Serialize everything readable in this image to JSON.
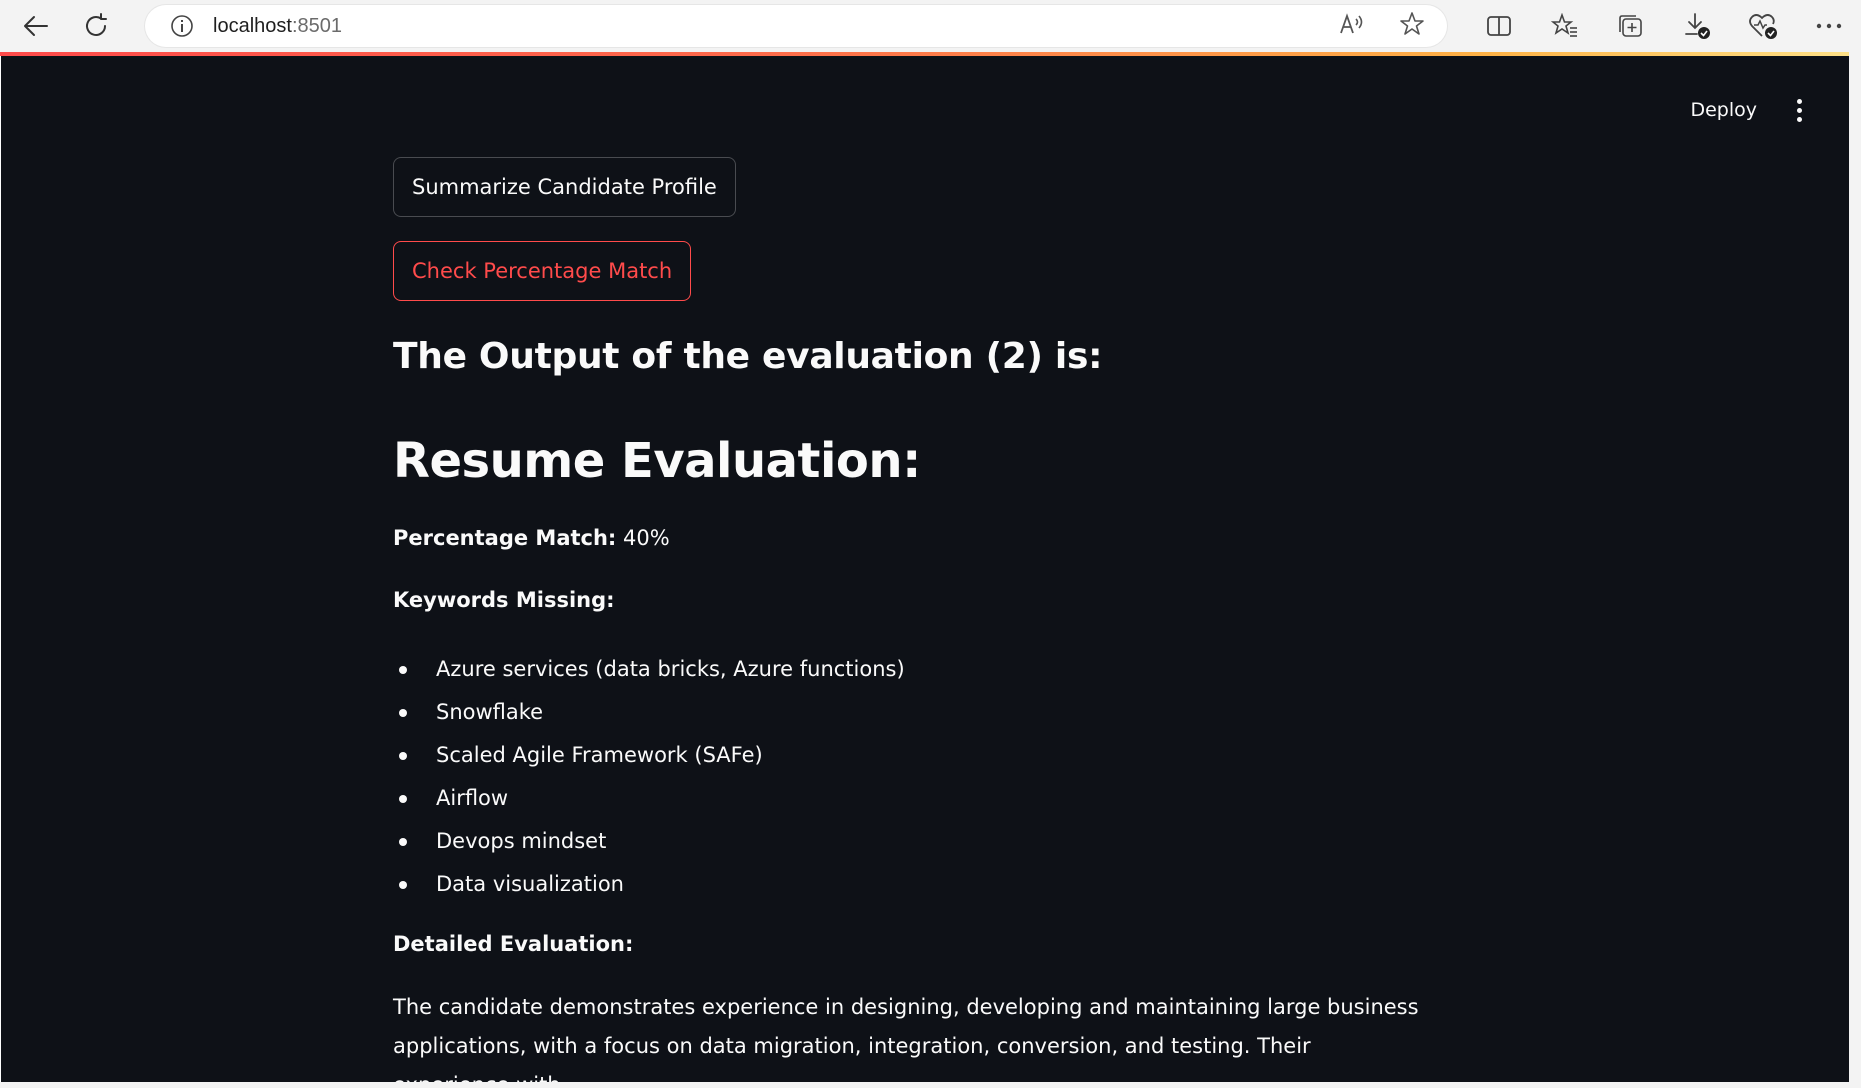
{
  "browser": {
    "url_host": "localhost",
    "url_port": ":8501"
  },
  "app": {
    "header": {
      "deploy_label": "Deploy"
    },
    "buttons": {
      "summarize": "Summarize Candidate Profile",
      "check_match": "Check Percentage Match"
    },
    "output_heading": "The Output of the evaluation (2) is:",
    "resume_heading": "Resume Evaluation:",
    "percentage_label": "Percentage Match:",
    "percentage_value": "40%",
    "keywords_label": "Keywords Missing:",
    "keywords": [
      "Azure services (data bricks, Azure functions)",
      "Snowflake",
      "Scaled Agile Framework (SAFe)",
      "Airflow",
      "Devops mindset",
      "Data visualization"
    ],
    "detailed_label": "Detailed Evaluation:",
    "detailed_text": "The candidate demonstrates experience in designing, developing and maintaining large business applications, with a focus on data migration, integration, conversion, and testing. Their experience with"
  },
  "colors": {
    "app_bg": "#0e1117",
    "text": "#fafafa",
    "accent": "#ff4b4b"
  }
}
